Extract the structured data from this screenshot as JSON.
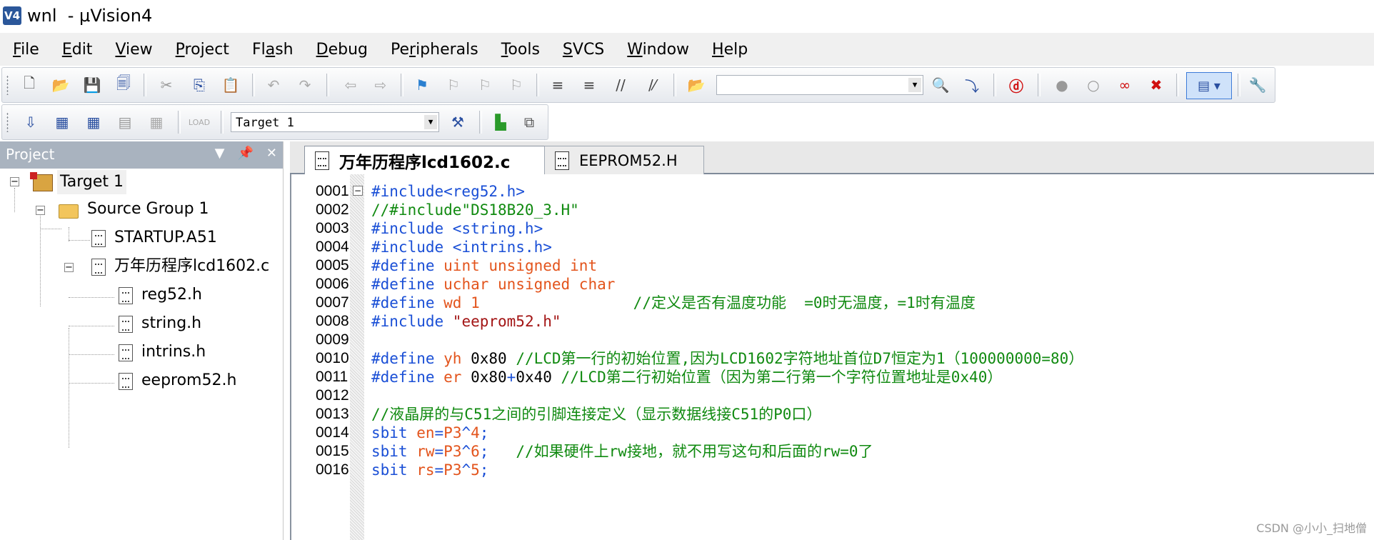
{
  "window": {
    "title": "wnl  - µVision4",
    "app_icon_label": "V4"
  },
  "menu": [
    "File",
    "Edit",
    "View",
    "Project",
    "Flash",
    "Debug",
    "Peripherals",
    "Tools",
    "SVCS",
    "Window",
    "Help"
  ],
  "menu_hotkeys": [
    "F",
    "E",
    "V",
    "P",
    "a",
    "D",
    "r",
    "T",
    "S",
    "W",
    "H"
  ],
  "toolbar2": {
    "target_select": "Target 1"
  },
  "project_panel": {
    "title": "Project",
    "tree": {
      "target": "Target 1",
      "group": "Source Group 1",
      "files": [
        "STARTUP.A51",
        "万年历程序lcd1602.c"
      ],
      "includes": [
        "reg52.h",
        "string.h",
        "intrins.h",
        "eeprom52.h"
      ]
    }
  },
  "tabs": [
    "万年历程序lcd1602.c",
    "EEPROM52.H"
  ],
  "code": [
    {
      "num": "0001",
      "parts": [
        [
          "dir",
          "#include<reg52.h>"
        ]
      ]
    },
    {
      "num": "0002",
      "parts": [
        [
          "comment",
          "//#include\"DS18B20_3.H\""
        ]
      ]
    },
    {
      "num": "0003",
      "parts": [
        [
          "dir",
          "#include <string.h>"
        ]
      ]
    },
    {
      "num": "0004",
      "parts": [
        [
          "dir",
          "#include <intrins.h>"
        ]
      ]
    },
    {
      "num": "0005",
      "parts": [
        [
          "dir",
          "#define "
        ],
        [
          "type",
          "uint unsigned int"
        ]
      ]
    },
    {
      "num": "0006",
      "parts": [
        [
          "dir",
          "#define "
        ],
        [
          "type",
          "uchar unsigned char"
        ]
      ]
    },
    {
      "num": "0007",
      "parts": [
        [
          "dir",
          "#define "
        ],
        [
          "type",
          "wd 1"
        ],
        [
          "plain",
          "                 "
        ],
        [
          "comment",
          "//定义是否有温度功能  =0时无温度，=1时有温度"
        ]
      ]
    },
    {
      "num": "0008",
      "parts": [
        [
          "dir",
          "#include "
        ],
        [
          "str",
          "\"eeprom52.h\""
        ]
      ]
    },
    {
      "num": "0009",
      "parts": []
    },
    {
      "num": "0010",
      "parts": [
        [
          "dir",
          "#define "
        ],
        [
          "type",
          "yh "
        ],
        [
          "plain",
          "0x80 "
        ],
        [
          "comment",
          "//LCD第一行的初始位置,因为LCD1602字符地址首位D7恒定为1（100000000=80）"
        ]
      ]
    },
    {
      "num": "0011",
      "parts": [
        [
          "dir",
          "#define "
        ],
        [
          "type",
          "er "
        ],
        [
          "plain",
          "0x80"
        ],
        [
          "op",
          "+"
        ],
        [
          "plain",
          "0x40 "
        ],
        [
          "comment",
          "//LCD第二行初始位置（因为第二行第一个字符位置地址是0x40）"
        ]
      ]
    },
    {
      "num": "0012",
      "parts": []
    },
    {
      "num": "0013",
      "parts": [
        [
          "comment",
          "//液晶屏的与C51之间的引脚连接定义（显示数据线接C51的P0口）"
        ]
      ]
    },
    {
      "num": "0014",
      "parts": [
        [
          "dir",
          "sbit "
        ],
        [
          "type",
          "en"
        ],
        [
          "op",
          "="
        ],
        [
          "type",
          "P3"
        ],
        [
          "op",
          "^"
        ],
        [
          "type",
          "4"
        ],
        [
          "op",
          ";"
        ]
      ]
    },
    {
      "num": "0015",
      "parts": [
        [
          "dir",
          "sbit "
        ],
        [
          "type",
          "rw"
        ],
        [
          "op",
          "="
        ],
        [
          "type",
          "P3"
        ],
        [
          "op",
          "^"
        ],
        [
          "type",
          "6"
        ],
        [
          "op",
          ";"
        ],
        [
          "plain",
          "   "
        ],
        [
          "comment",
          "//如果硬件上rw接地，就不用写这句和后面的rw=0了"
        ]
      ]
    },
    {
      "num": "0016",
      "parts": [
        [
          "dir",
          "sbit "
        ],
        [
          "type",
          "rs"
        ],
        [
          "op",
          "="
        ],
        [
          "type",
          "P3"
        ],
        [
          "op",
          "^"
        ],
        [
          "type",
          "5"
        ],
        [
          "op",
          ";"
        ]
      ]
    }
  ],
  "watermark": "CSDN @小小_扫地僧",
  "colors": {
    "directive": "#1a4fd6",
    "type": "#e3541c",
    "comment": "#108a10",
    "string": "#a31515",
    "panel_header": "#a9b3bf"
  }
}
